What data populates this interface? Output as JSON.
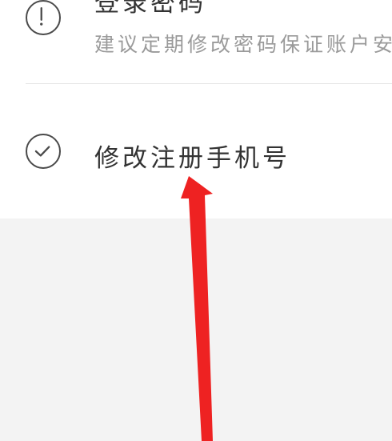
{
  "settings": {
    "login_password": {
      "title": "登录密码",
      "subtitle": "建议定期修改密码保证账户安",
      "icon": "warning-icon"
    },
    "change_phone": {
      "title": "修改注册手机号",
      "icon": "check-circle-icon"
    }
  },
  "colors": {
    "arrow": "#ee2222",
    "background": "#f3f3f3",
    "card": "#ffffff",
    "text_primary": "#333333",
    "text_secondary": "#9a9a9a"
  }
}
